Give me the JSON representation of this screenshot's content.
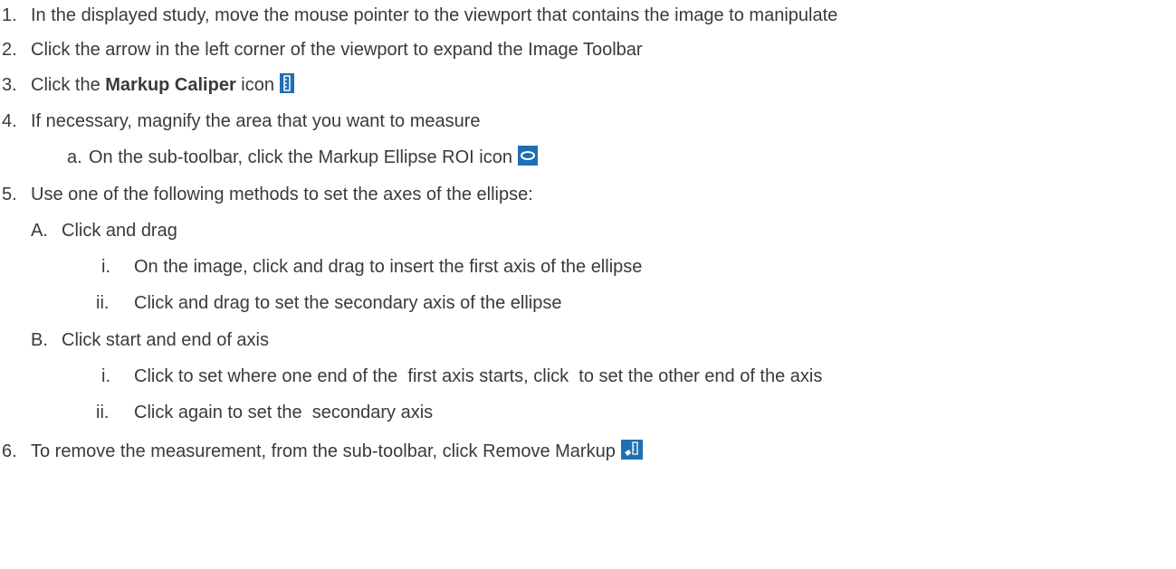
{
  "steps": [
    {
      "num": "1.",
      "text": "In the displayed study, move the mouse pointer to the viewport that contains the image to manipulate"
    },
    {
      "num": "2.",
      "text": "Click the arrow in the left corner of the viewport to expand the Image Toolbar"
    },
    {
      "num": "3.",
      "text_before": "Click the ",
      "bold": "Markup Caliper",
      "text_after": " icon",
      "icon": "markup-caliper-icon"
    },
    {
      "num": "4.",
      "text": "If necessary, magnify the area that you want to measure"
    },
    {
      "num": "a.",
      "text": "On the sub-toolbar, click the Markup Ellipse ROI icon",
      "icon": "markup-ellipse-roi-icon"
    },
    {
      "num": "5.",
      "text": "Use one of the following methods to set the axes of the ellipse:"
    },
    {
      "num": "A.",
      "text": "Click and drag"
    },
    {
      "num": "i.",
      "text": "On the image, click and drag to insert the first axis of the ellipse"
    },
    {
      "num": "ii.",
      "text": "Click and drag to set the secondary axis of the ellipse"
    },
    {
      "num": "B.",
      "text": "Click start and end of axis"
    },
    {
      "num": "i.",
      "text": "Click to set where one end of the  first axis starts, click  to set the other end of the axis"
    },
    {
      "num": "ii.",
      "text": "Click again to set the  secondary axis"
    },
    {
      "num": "6.",
      "text": "To remove the measurement, from the sub-toolbar, click Remove Markup",
      "icon": "remove-markup-icon"
    }
  ],
  "colors": {
    "text": "#3a3a3a",
    "icon_bg": "#1f6fb5",
    "icon_fg": "#ffffff"
  }
}
